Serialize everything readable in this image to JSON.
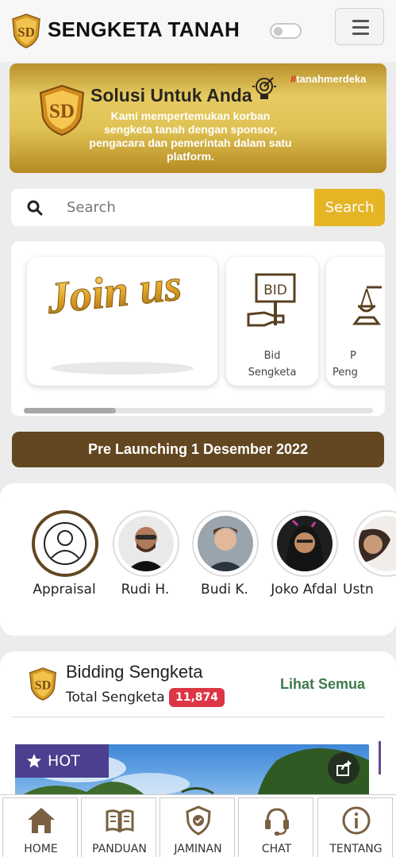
{
  "header": {
    "app_title": "SENGKETA TANAH",
    "logo_letters": "SD"
  },
  "banner": {
    "title": "Solusi Untuk Anda",
    "hashtag_mark": "#",
    "hashtag_text": "tanahmerdeka",
    "subtitle": "Kami mempertemukan korban sengketa tanah dengan sponsor, pengacara dan pemerintah dalam satu platform."
  },
  "search": {
    "placeholder": "Search",
    "button_label": "Search"
  },
  "categories": {
    "join_card_text": "Join us",
    "items": [
      {
        "icon": "bid-sign-icon",
        "label_line1": "Bid",
        "label_line2": "Sengketa"
      },
      {
        "icon": "justice-scale-icon",
        "label_line1": "P",
        "label_line2": "Peng"
      }
    ]
  },
  "prelaunch": {
    "label": "Pre Launching 1 Desember 2022"
  },
  "people": [
    {
      "name": "Appraisal",
      "icon": "user-outline-icon"
    },
    {
      "name": "Rudi H."
    },
    {
      "name": "Budi K."
    },
    {
      "name": "Joko Afdal"
    },
    {
      "name": "Ustn"
    }
  ],
  "bidding": {
    "title": "Bidding Sengketa",
    "total_label": "Total Sengketa",
    "total_count": "11,874",
    "see_all": "Lihat Semua",
    "badge": "HOT"
  },
  "bottom_nav": [
    {
      "label": "HOME",
      "icon": "home-icon"
    },
    {
      "label": "PANDUAN",
      "icon": "book-icon"
    },
    {
      "label": "JAMINAN",
      "icon": "shield-check-icon"
    },
    {
      "label": "CHAT",
      "icon": "headset-icon"
    },
    {
      "label": "TENTANG",
      "icon": "info-icon"
    }
  ],
  "colors": {
    "gold": "#e5b526",
    "brown": "#634720",
    "nav_icon": "#7a6040",
    "badge_red": "#dc3545",
    "link_green": "#3f7a4a",
    "hot_purple": "#4b3f8f"
  }
}
